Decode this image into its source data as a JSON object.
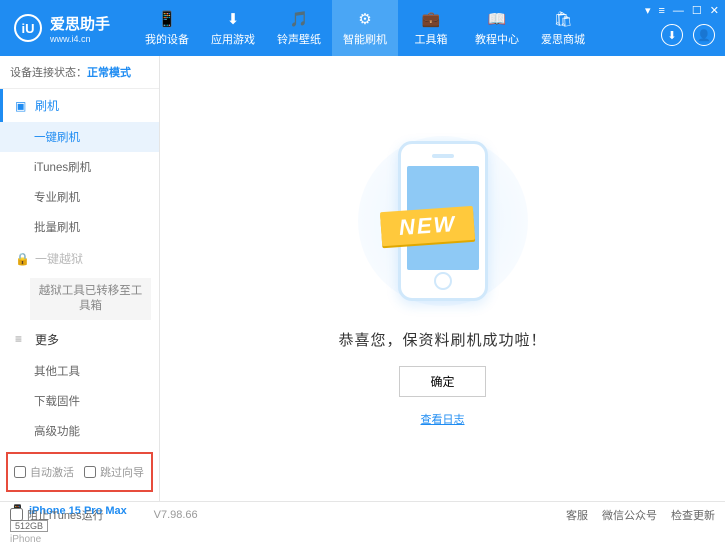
{
  "header": {
    "app_name": "爱思助手",
    "url": "www.i4.cn",
    "logo_letters": "iU",
    "nav": [
      {
        "label": "我的设备",
        "icon": "📱"
      },
      {
        "label": "应用游戏",
        "icon": "⬇"
      },
      {
        "label": "铃声壁纸",
        "icon": "🎵"
      },
      {
        "label": "智能刷机",
        "icon": "⚙",
        "active": true
      },
      {
        "label": "工具箱",
        "icon": "💼"
      },
      {
        "label": "教程中心",
        "icon": "📖"
      },
      {
        "label": "爱思商城",
        "icon": "🛍"
      }
    ]
  },
  "sidebar": {
    "status_label": "设备连接状态：",
    "status_value": "正常模式",
    "sections": {
      "flash": {
        "title": "刷机",
        "items": [
          "一键刷机",
          "iTunes刷机",
          "专业刷机",
          "批量刷机"
        ]
      },
      "jailbreak": {
        "title": "一键越狱",
        "note": "越狱工具已转移至工具箱"
      },
      "more": {
        "title": "更多",
        "items": [
          "其他工具",
          "下载固件",
          "高级功能"
        ]
      }
    },
    "checkboxes": {
      "auto_activate": "自动激活",
      "skip_guide": "跳过向导"
    },
    "device": {
      "name": "iPhone 15 Pro Max",
      "storage": "512GB",
      "type": "iPhone"
    }
  },
  "main": {
    "ribbon": "NEW",
    "success": "恭喜您，保资料刷机成功啦！",
    "ok": "确定",
    "log_link": "查看日志"
  },
  "footer": {
    "block_itunes": "阻止iTunes运行",
    "version": "V7.98.66",
    "links": [
      "客服",
      "微信公众号",
      "检查更新"
    ]
  }
}
